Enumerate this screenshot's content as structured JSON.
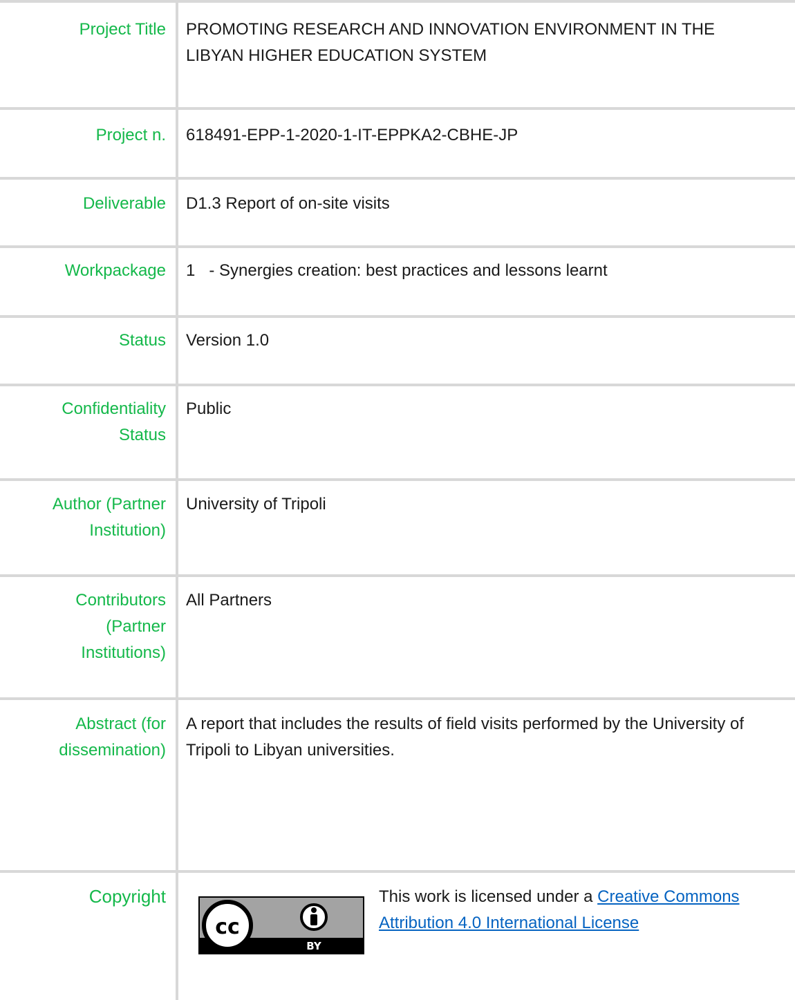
{
  "rows": [
    {
      "label": "Project Title",
      "value": "PROMOTING RESEARCH AND INNOVATION ENVIRONMENT IN THE LIBYAN HIGHER EDUCATION SYSTEM"
    },
    {
      "label": "Project n.",
      "value": "618491-EPP-1-2020-1-IT-EPPKA2-CBHE-JP"
    },
    {
      "label": "Deliverable",
      "value": "D1.3 Report of on-site visits"
    },
    {
      "label": "Workpackage",
      "value": "1   - Synergies creation: best practices and lessons learnt"
    },
    {
      "label": "Status",
      "value": "Version 1.0"
    },
    {
      "label": "Confidentiality Status",
      "value": "Public"
    },
    {
      "label": "Author (Partner Institution)",
      "value": "University of Tripoli"
    },
    {
      "label": "Contributors (Partner Institutions)",
      "value": "All Partners"
    },
    {
      "label": "Abstract (for dissemination)",
      "value": "A report that includes the results of field visits performed by the University of Tripoli to Libyan universities."
    }
  ],
  "copyright": {
    "label": "Copyright",
    "license_prefix": "This work is licensed under a ",
    "license_link": "Creative Commons Attribution 4.0 International License",
    "badge_text": "BY",
    "badge_logo": "cc"
  },
  "colors": {
    "label": "#14b84a",
    "text": "#1a1a1a",
    "link": "#0563c1",
    "border": "#d8d8d8"
  }
}
